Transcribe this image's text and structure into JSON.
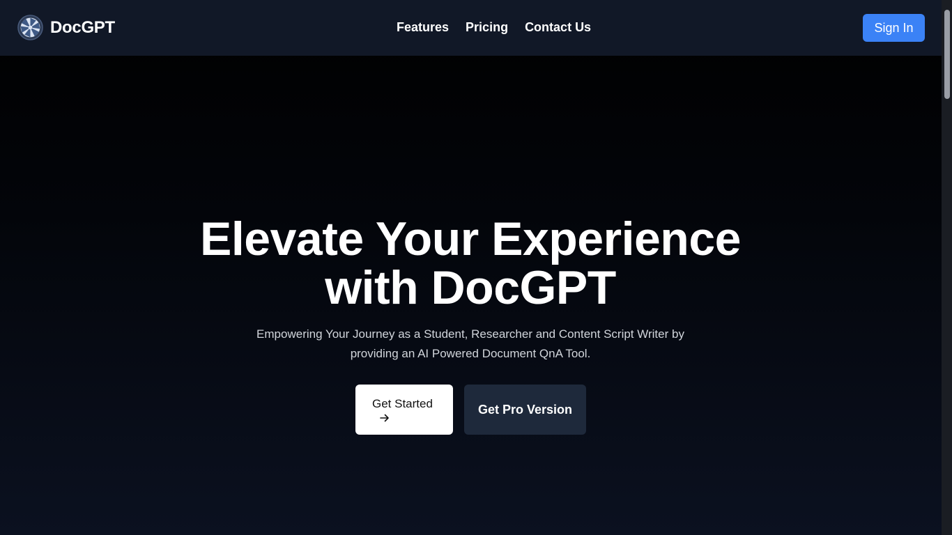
{
  "header": {
    "brand_name": "DocGPT",
    "logo_icon": "aperture-logo-icon",
    "nav": [
      {
        "label": "Features"
      },
      {
        "label": "Pricing"
      },
      {
        "label": "Contact Us"
      }
    ],
    "signin_label": "Sign In"
  },
  "hero": {
    "title_line1": "Elevate Your Experience",
    "title_line2": "with DocGPT",
    "subtitle_line1": "Empowering Your Journey as a Student, Researcher and Content Script Writer by",
    "subtitle_line2": "providing an AI Powered Document QnA Tool.",
    "primary_button_label": "Get Started",
    "primary_button_icon": "arrow-right-icon",
    "secondary_button_label": "Get Pro Version"
  },
  "colors": {
    "navbar_bg": "#111827",
    "accent": "#3b82f6",
    "hero_bg": "#000000",
    "secondary_button_bg": "#1e293b"
  }
}
